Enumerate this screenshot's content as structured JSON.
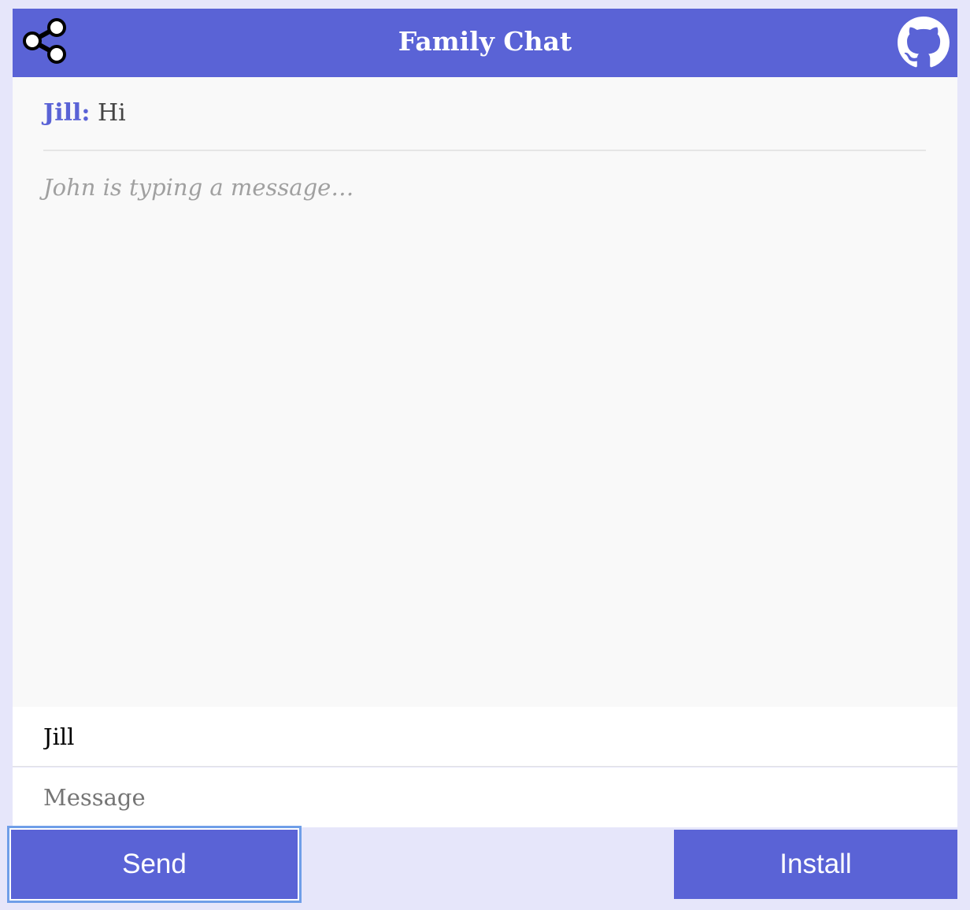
{
  "header": {
    "title": "Family Chat",
    "share_icon": "share-icon",
    "github_icon": "github-icon",
    "color": "#5a63d6"
  },
  "messages": [
    {
      "author": "Jill:",
      "text": "Hi"
    }
  ],
  "typing_indicator": "John is typing a message…",
  "form": {
    "name_value": "Jill",
    "message_placeholder": "Message"
  },
  "buttons": {
    "send_label": "Send",
    "install_label": "Install"
  },
  "colors": {
    "accent": "#5a63d6",
    "page_background": "#e6e6fa",
    "chat_background": "#f9f9f9"
  }
}
